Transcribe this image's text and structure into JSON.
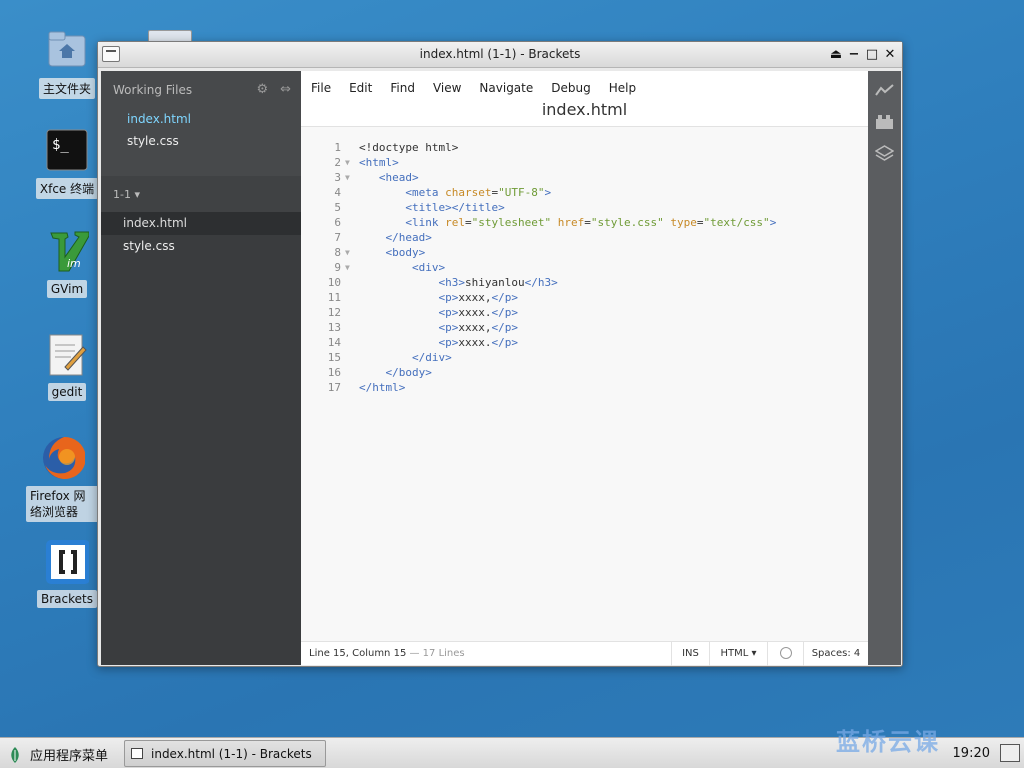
{
  "desktop": {
    "icons": [
      {
        "label": "主文件夹"
      },
      {
        "label": "Xfce 终端"
      },
      {
        "label": "GVim"
      },
      {
        "label": "gedit"
      },
      {
        "label": "Firefox 网络浏览器"
      },
      {
        "label": "Brackets"
      }
    ]
  },
  "window": {
    "title": "index.html (1-1) - Brackets",
    "controls": [
      "⏏",
      "−",
      "□",
      "✕"
    ]
  },
  "sidebar": {
    "header": "Working Files",
    "working_files": [
      {
        "name": "index.html",
        "active": true
      },
      {
        "name": "style.css",
        "active": false
      }
    ],
    "pane_label": "1-1 ▾",
    "pane_files": [
      {
        "name": "index.html",
        "selected": true
      },
      {
        "name": "style.css",
        "selected": false
      }
    ]
  },
  "menu": {
    "items": [
      "File",
      "Edit",
      "Find",
      "View",
      "Navigate",
      "Debug",
      "Help"
    ],
    "doc_title": "index.html"
  },
  "editor": {
    "lines": [
      {
        "n": "1",
        "fold": false,
        "html": "&lt;!doctype html&gt;"
      },
      {
        "n": "2",
        "fold": true,
        "html": "<span class='t'>&lt;html&gt;</span>"
      },
      {
        "n": "3",
        "fold": true,
        "html": "   <span class='t'>&lt;head&gt;</span>"
      },
      {
        "n": "4",
        "fold": false,
        "html": "       <span class='t'>&lt;meta</span> <span class='a'>charset</span>=<span class='v'>\"UTF-8\"</span><span class='t'>&gt;</span>"
      },
      {
        "n": "5",
        "fold": false,
        "html": "       <span class='t'>&lt;title&gt;&lt;/title&gt;</span>"
      },
      {
        "n": "6",
        "fold": false,
        "html": "       <span class='t'>&lt;link</span> <span class='a'>rel</span>=<span class='v'>\"stylesheet\"</span> <span class='a'>href</span>=<span class='v'>\"style.css\"</span> <span class='a'>type</span>=<span class='v'>\"text/css\"</span><span class='t'>&gt;</span>"
      },
      {
        "n": "7",
        "fold": false,
        "html": "    <span class='t'>&lt;/head&gt;</span>"
      },
      {
        "n": "8",
        "fold": true,
        "html": "    <span class='t'>&lt;body&gt;</span>"
      },
      {
        "n": "9",
        "fold": true,
        "html": "        <span class='t'>&lt;div&gt;</span>"
      },
      {
        "n": "10",
        "fold": false,
        "html": "            <span class='t'>&lt;h3&gt;</span>shiyanlou<span class='t'>&lt;/h3&gt;</span>"
      },
      {
        "n": "11",
        "fold": false,
        "html": "            <span class='t'>&lt;p&gt;</span>xxxx,<span class='t'>&lt;/p&gt;</span>"
      },
      {
        "n": "12",
        "fold": false,
        "html": "            <span class='t'>&lt;p&gt;</span>xxxx.<span class='t'>&lt;/p&gt;</span>"
      },
      {
        "n": "13",
        "fold": false,
        "html": "            <span class='t'>&lt;p&gt;</span>xxxx,<span class='t'>&lt;/p&gt;</span>"
      },
      {
        "n": "14",
        "fold": false,
        "html": "            <span class='t'>&lt;p&gt;</span>xxxx.<span class='t'>&lt;/p&gt;</span>"
      },
      {
        "n": "15",
        "fold": false,
        "html": "        <span class='t'>&lt;/div&gt;</span>"
      },
      {
        "n": "16",
        "fold": false,
        "html": "    <span class='t'>&lt;/body&gt;</span>"
      },
      {
        "n": "17",
        "fold": false,
        "html": "<span class='t'>&lt;/html&gt;</span>"
      }
    ]
  },
  "status": {
    "position": "Line 15, Column 15",
    "lines_info": "— 17 Lines",
    "mode": "INS",
    "language": "HTML ▾",
    "spaces": "Spaces: 4"
  },
  "taskbar": {
    "start_label": "应用程序菜单",
    "task_label": "index.html (1-1) - Brackets",
    "clock": "19:20"
  },
  "watermark": "蓝桥云课",
  "colors": {
    "tag": "#446fbd",
    "attr": "#c78a27",
    "value": "#6f9b36",
    "active_file": "#7fd6ff"
  }
}
